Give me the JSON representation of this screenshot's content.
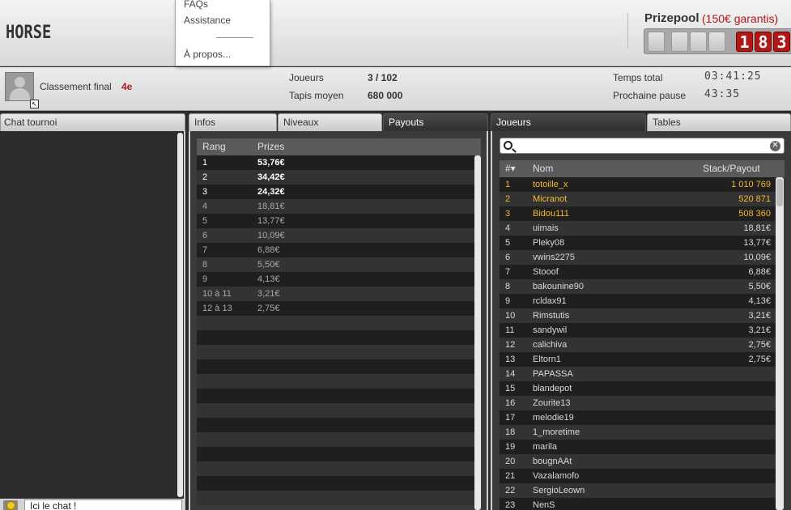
{
  "header": {
    "title": "HORSE",
    "prizepool_label": "Prizepool",
    "prizepool_guarantee": "(150€ garantis)",
    "prize_digits": [
      "",
      "",
      "",
      "",
      "1",
      "8",
      "3"
    ]
  },
  "menu": {
    "items": [
      "FAQs",
      "Assistance",
      "À propos..."
    ]
  },
  "status": {
    "rank_label": "Classement final",
    "rank_value": "4e",
    "players_label": "Joueurs",
    "players_value": "3 / 102",
    "avg_stack_label": "Tapis moyen",
    "avg_stack_value": "680 000",
    "total_time_label": "Temps total",
    "total_time_value": "03:41:25",
    "next_break_label": "Prochaine pause",
    "next_break_value": "43:35"
  },
  "chat": {
    "tab_label": "Chat tournoi",
    "input_value": "Ici le chat !"
  },
  "middle": {
    "tabs": [
      "Infos",
      "Niveaux",
      "Payouts"
    ],
    "active_tab": 2,
    "columns": [
      "Rang",
      "Prizes"
    ],
    "rows": [
      {
        "rank": "1",
        "prize": "53,76€",
        "highlight": true
      },
      {
        "rank": "2",
        "prize": "34,42€",
        "highlight": true
      },
      {
        "rank": "3",
        "prize": "24,32€",
        "highlight": true
      },
      {
        "rank": "4",
        "prize": "18,81€",
        "highlight": false
      },
      {
        "rank": "5",
        "prize": "13,77€",
        "highlight": false
      },
      {
        "rank": "6",
        "prize": "10,09€",
        "highlight": false
      },
      {
        "rank": "7",
        "prize": "6,88€",
        "highlight": false
      },
      {
        "rank": "8",
        "prize": "5,50€",
        "highlight": false
      },
      {
        "rank": "9",
        "prize": "4,13€",
        "highlight": false
      },
      {
        "rank": "10 à 11",
        "prize": "3,21€",
        "highlight": false
      },
      {
        "rank": "12 à 13",
        "prize": "2,75€",
        "highlight": false
      }
    ],
    "empty_rows": 13
  },
  "players": {
    "tabs": [
      "Joueurs",
      "Tables"
    ],
    "active_tab": 0,
    "search_placeholder": "",
    "columns": [
      "#▾",
      "Nom",
      "Stack/Payout"
    ],
    "rows": [
      {
        "rank": "1",
        "name": "totoille_x",
        "value": "1 010 769",
        "active": true
      },
      {
        "rank": "2",
        "name": "Micranot",
        "value": "520 871",
        "active": true
      },
      {
        "rank": "3",
        "name": "Bidou111",
        "value": "508 360",
        "active": true
      },
      {
        "rank": "4",
        "name": "uimais",
        "value": "18,81€",
        "active": false
      },
      {
        "rank": "5",
        "name": "Pleky08",
        "value": "13,77€",
        "active": false
      },
      {
        "rank": "6",
        "name": "vwins2275",
        "value": "10,09€",
        "active": false
      },
      {
        "rank": "7",
        "name": "Stooof",
        "value": "6,88€",
        "active": false
      },
      {
        "rank": "8",
        "name": "bakounine90",
        "value": "5,50€",
        "active": false
      },
      {
        "rank": "9",
        "name": "rcldax91",
        "value": "4,13€",
        "active": false
      },
      {
        "rank": "10",
        "name": "Rimstutis",
        "value": "3,21€",
        "active": false
      },
      {
        "rank": "11",
        "name": "sandywil",
        "value": "3,21€",
        "active": false
      },
      {
        "rank": "12",
        "name": "calichiva",
        "value": "2,75€",
        "active": false
      },
      {
        "rank": "13",
        "name": "Eltorn1",
        "value": "2,75€",
        "active": false
      },
      {
        "rank": "14",
        "name": "PAPASSA",
        "value": "",
        "active": false
      },
      {
        "rank": "15",
        "name": "blandepot",
        "value": "",
        "active": false
      },
      {
        "rank": "16",
        "name": "Zourite13",
        "value": "",
        "active": false
      },
      {
        "rank": "17",
        "name": "melodie19",
        "value": "",
        "active": false
      },
      {
        "rank": "18",
        "name": "1_moretime",
        "value": "",
        "active": false
      },
      {
        "rank": "19",
        "name": "marila",
        "value": "",
        "active": false
      },
      {
        "rank": "20",
        "name": "bougnAAt",
        "value": "",
        "active": false
      },
      {
        "rank": "21",
        "name": "Vazalamofo",
        "value": "",
        "active": false
      },
      {
        "rank": "22",
        "name": "SergioLeown",
        "value": "",
        "active": false
      },
      {
        "rank": "23",
        "name": "NenS",
        "value": "",
        "active": false
      }
    ]
  },
  "colors": {
    "accent_red": "#b01818",
    "active_player": "#f5b82a",
    "prize_top": "#ffffff",
    "prize_rest": "#a8a8a8",
    "row_dark": "#1f1f1f",
    "row_light": "#333333"
  }
}
